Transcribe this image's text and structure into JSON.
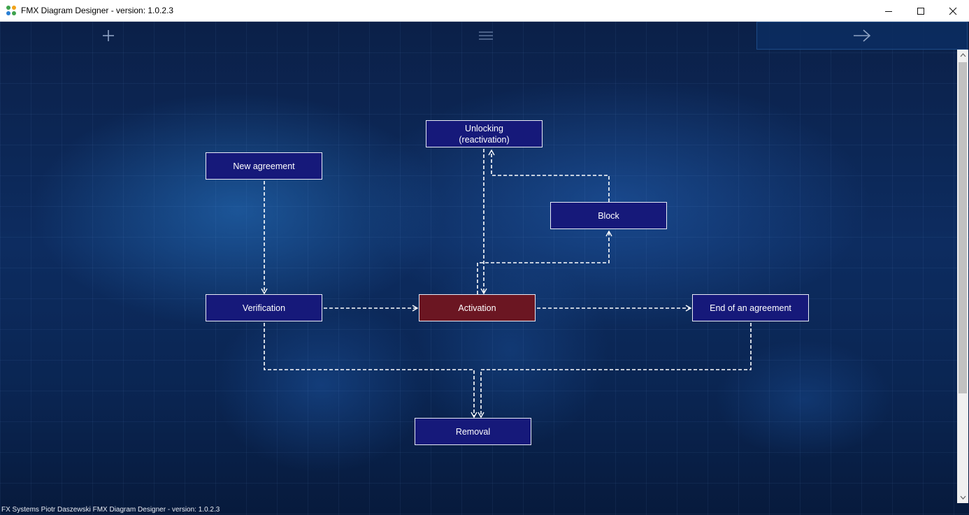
{
  "window": {
    "title": "FMX Diagram Designer - version: 1.0.2.3",
    "controls": {
      "minimize": "minimize-icon",
      "maximize": "maximize-icon",
      "close": "close-icon"
    }
  },
  "toolbar": {
    "add_icon": "plus-icon",
    "menu_icon": "hamburger-icon",
    "next_icon": "arrow-right-icon"
  },
  "diagram": {
    "nodes": {
      "new_agreement": "New agreement",
      "unlocking_line1": "Unlocking",
      "unlocking_line2": "(reactivation)",
      "block": "Block",
      "verification": "Verification",
      "activation": "Activation",
      "end_agreement": "End of an agreement",
      "removal": "Removal"
    },
    "colors": {
      "node_fill": "#16197a",
      "active_fill": "#6b1622",
      "connector": "#ffffff"
    }
  },
  "footer": {
    "text": "FX Systems Piotr Daszewski FMX Diagram Designer - version: 1.0.2.3"
  }
}
